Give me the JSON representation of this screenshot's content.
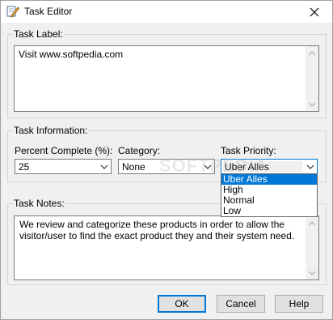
{
  "window": {
    "title": "Task Editor",
    "icon": "pencil-document-icon",
    "close_icon": "close-icon"
  },
  "task_label": {
    "group_title": "Task Label:",
    "value": "Visit www.softpedia.com"
  },
  "task_information": {
    "group_title": "Task Information:",
    "percent_complete": {
      "label": "Percent Complete (%):",
      "value": "25"
    },
    "category": {
      "label": "Category:",
      "value": "None"
    },
    "task_priority": {
      "label": "Task Priority:",
      "value": "Uber Alles",
      "options": [
        "Uber Alles",
        "High",
        "Normal",
        "Low"
      ],
      "highlighted_option": "Uber Alles"
    }
  },
  "task_notes": {
    "group_title": "Task Notes:",
    "value": "We review and categorize these products in order to allow the visitor/user to find the exact product they and their system need."
  },
  "buttons": {
    "ok": "OK",
    "cancel": "Cancel",
    "help": "Help"
  },
  "watermark": "SOFTPEDIA",
  "colors": {
    "accent": "#0078d7",
    "selection": "#0078d7"
  }
}
